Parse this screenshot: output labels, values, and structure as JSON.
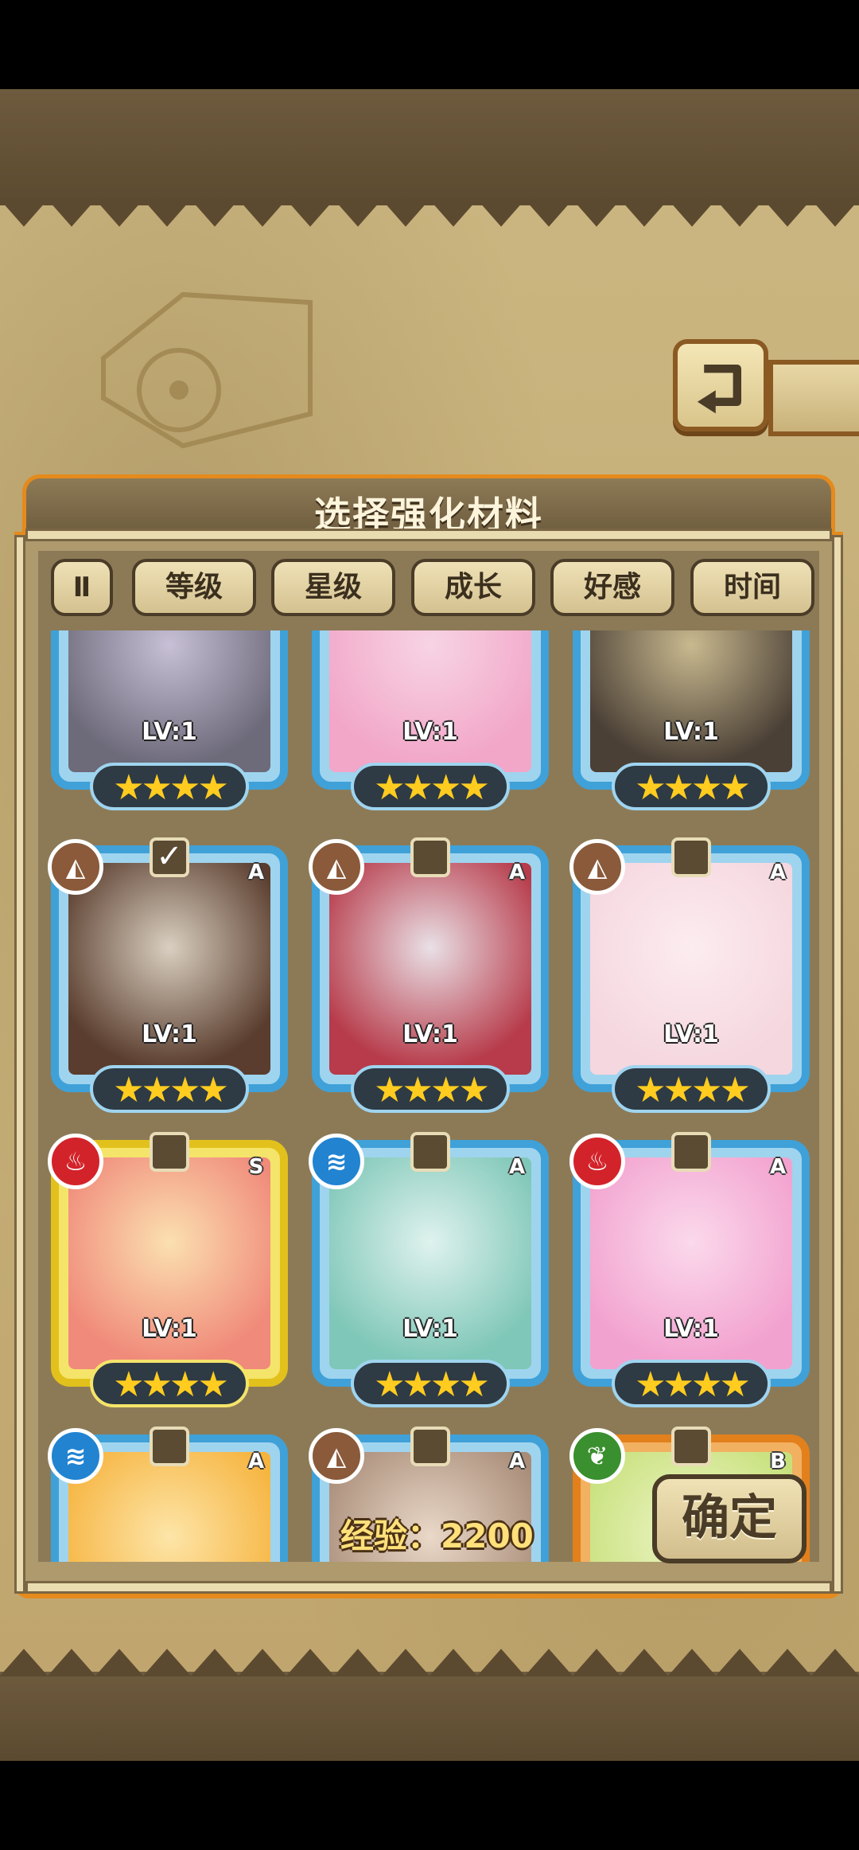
{
  "panel": {
    "title": "选择强化材料"
  },
  "filters": {
    "sort_icon": "Ⅱ",
    "buttons": [
      "等级",
      "星级",
      "成长",
      "好感",
      "时间"
    ]
  },
  "cards": [
    {
      "lv": "LV:1",
      "stars": "★★★★",
      "rank": "",
      "element": "",
      "checked": false
    },
    {
      "lv": "LV:1",
      "stars": "★★★★",
      "rank": "",
      "element": "",
      "checked": false
    },
    {
      "lv": "LV:1",
      "stars": "★★★★",
      "rank": "",
      "element": "",
      "checked": false
    },
    {
      "lv": "LV:1",
      "stars": "★★★★",
      "rank": "A",
      "element": "earth",
      "checked": true
    },
    {
      "lv": "LV:1",
      "stars": "★★★★",
      "rank": "A",
      "element": "earth",
      "checked": false
    },
    {
      "lv": "LV:1",
      "stars": "★★★★",
      "rank": "A",
      "element": "earth",
      "checked": false
    },
    {
      "lv": "LV:1",
      "stars": "★★★★",
      "rank": "S",
      "element": "fire",
      "checked": false
    },
    {
      "lv": "LV:1",
      "stars": "★★★★",
      "rank": "A",
      "element": "water",
      "checked": false
    },
    {
      "lv": "LV:1",
      "stars": "★★★★",
      "rank": "A",
      "element": "fire",
      "checked": false
    },
    {
      "lv": "",
      "stars": "",
      "rank": "A",
      "element": "water",
      "checked": false
    },
    {
      "lv": "",
      "stars": "",
      "rank": "A",
      "element": "earth",
      "checked": false
    },
    {
      "lv": "",
      "stars": "",
      "rank": "B",
      "element": "wood",
      "checked": false
    }
  ],
  "exp": {
    "label": "经验：2200"
  },
  "confirm": {
    "label": "确定"
  },
  "colors": {
    "rank_A": "#3fa1d8",
    "rank_S": "#e2c11c",
    "rank_B": "#e2801c",
    "panel_border": "#e58a1c"
  }
}
